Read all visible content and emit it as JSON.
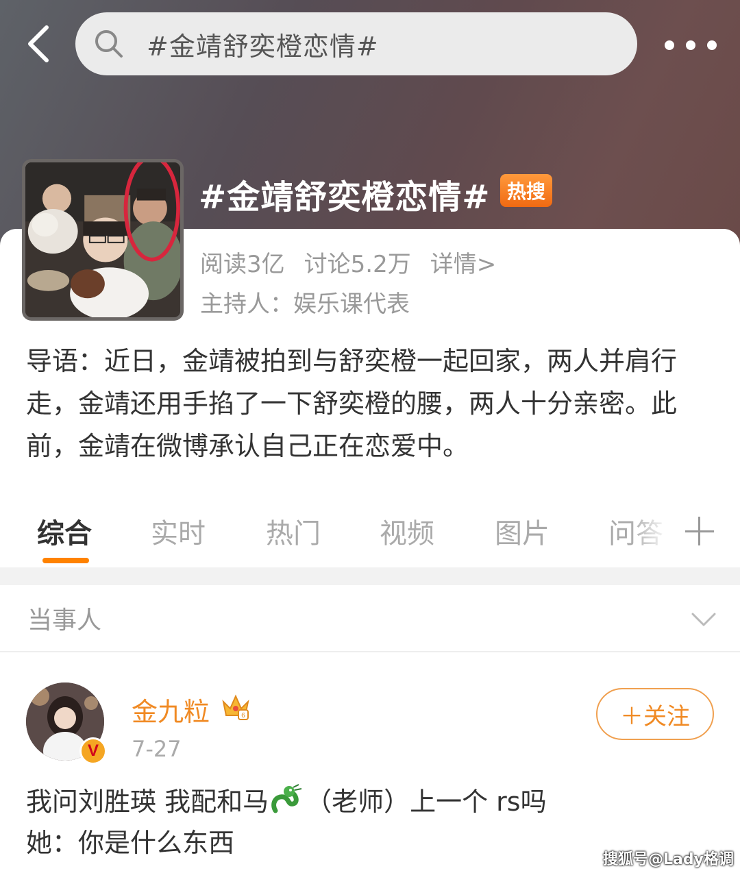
{
  "search": {
    "query": "#金靖舒奕橙恋情#"
  },
  "topic": {
    "title": "#金靖舒奕橙恋情#",
    "badge": "热搜",
    "reads": "阅读3亿",
    "discussions": "讨论5.2万",
    "details_link": "详情>",
    "host": "主持人：娱乐课代表",
    "intro": "导语：近日，金靖被拍到与舒奕橙一起回家，两人并肩行走，金靖还用手掐了一下舒奕橙的腰，两人十分亲密。此前，金靖在微博承认自己正在恋爱中。"
  },
  "tabs": [
    {
      "label": "综合",
      "active": true
    },
    {
      "label": "实时",
      "active": false
    },
    {
      "label": "热门",
      "active": false
    },
    {
      "label": "视频",
      "active": false
    },
    {
      "label": "图片",
      "active": false
    },
    {
      "label": "问答",
      "active": false
    }
  ],
  "section": {
    "title": "当事人"
  },
  "post": {
    "username": "金九粒",
    "date": "7-27",
    "follow_label": "＋关注",
    "verified_mark": "V",
    "line1_before": "我问刘胜瑛 我配和马",
    "line1_after": "（老师）上一个 rs吗",
    "line2": "她：你是什么东西"
  },
  "watermark": "搜狐号@Lady格调",
  "colors": {
    "accent": "#ff8200",
    "username": "#f08a24",
    "badge": "#f06a12",
    "verified_badge": "#f5a623"
  },
  "icons": [
    "back-arrow-icon",
    "search-icon",
    "more-icon",
    "chevron-down-icon",
    "crown-icon",
    "dragon-emoji-icon",
    "plus-icon"
  ]
}
